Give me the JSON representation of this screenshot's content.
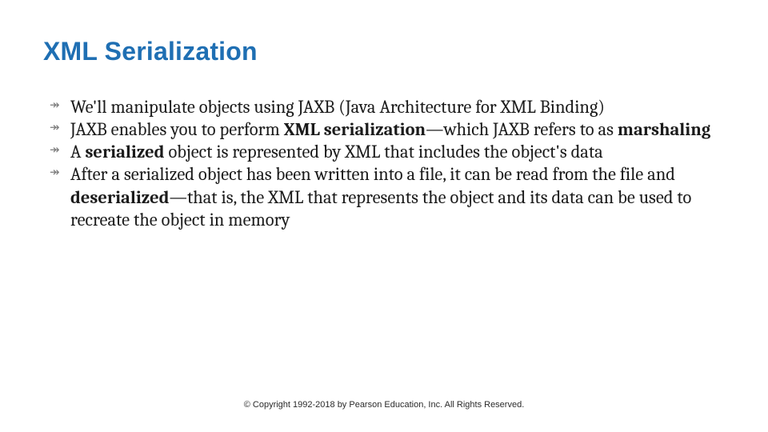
{
  "title": "XML Serialization",
  "items": [
    {
      "segments": [
        {
          "t": "We'll manipulate objects using JAXB (Java Architecture for XML Binding)",
          "bold": false
        }
      ]
    },
    {
      "segments": [
        {
          "t": "JAXB enables you to perform ",
          "bold": false
        },
        {
          "t": "XML serialization",
          "bold": true
        },
        {
          "t": "—which JAXB refers to as ",
          "bold": false
        },
        {
          "t": "marshaling",
          "bold": true
        }
      ]
    },
    {
      "segments": [
        {
          "t": "A ",
          "bold": false
        },
        {
          "t": "serialized",
          "bold": true
        },
        {
          "t": " object is represented by XML that includes the object's data",
          "bold": false
        }
      ]
    },
    {
      "segments": [
        {
          "t": "After a serialized object has been written into a file, it can be read from the file and ",
          "bold": false
        },
        {
          "t": "deserialized",
          "bold": true
        },
        {
          "t": "—that is, the XML that represents the object and its data can be used to recreate the object in memory",
          "bold": false
        }
      ]
    }
  ],
  "footer": "© Copyright 1992-2018 by Pearson Education, Inc. All Rights Reserved."
}
